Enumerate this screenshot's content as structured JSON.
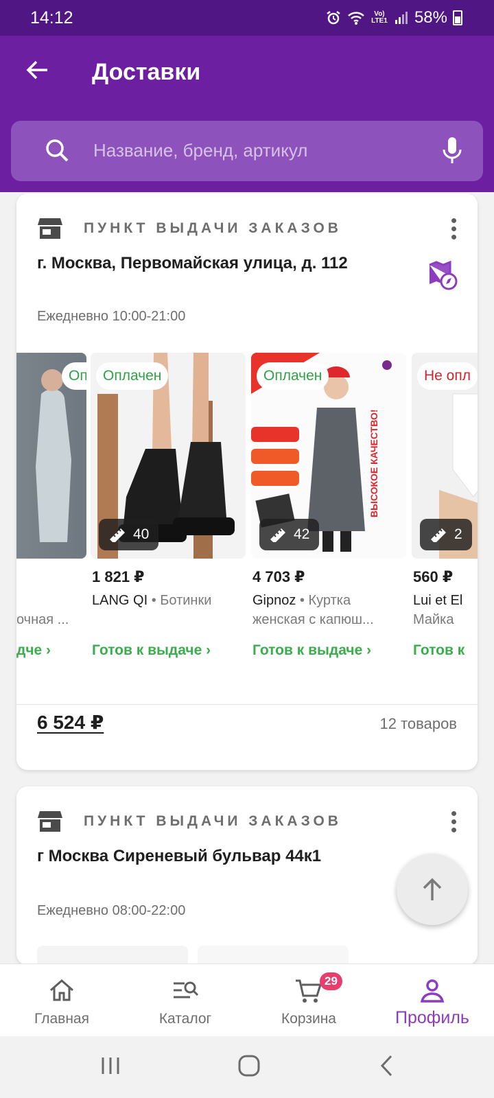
{
  "status_bar": {
    "time": "14:12",
    "network": "Vo) LTE1",
    "battery": "58%"
  },
  "header": {
    "title": "Доставки"
  },
  "search": {
    "placeholder": "Название, бренд, артикул"
  },
  "pickup_points": [
    {
      "type_label": "ПУНКТ ВЫДАЧИ ЗАКАЗОВ",
      "address": "г. Москва, Первомайская улица, д. 112",
      "hours": "Ежедневно 10:00-21:00",
      "products": [
        {
          "badge": "Оплачен",
          "size": "",
          "price": "",
          "brand": "",
          "category": "",
          "name": "очная ...",
          "status": "дче ›"
        },
        {
          "badge": "Оплачен",
          "size": "40",
          "price": "1 821 ₽",
          "brand": "LANG QI",
          "category": "Ботинки",
          "name": "",
          "status": "Готов к выдаче ›"
        },
        {
          "badge": "Оплачен",
          "size": "42",
          "price": "4 703 ₽",
          "brand": "Gipnoz",
          "category": "Куртка",
          "name": "женская с капюш...",
          "status": "Готов к выдаче ›"
        },
        {
          "badge": "Не опл",
          "size": "2",
          "price": "560 ₽",
          "brand": "Lui et El",
          "category": "",
          "name": "Майка",
          "status": "Готов к"
        }
      ],
      "total": "6 524 ₽",
      "items_count": "12 товаров"
    },
    {
      "type_label": "ПУНКТ ВЫДАЧИ ЗАКАЗОВ",
      "address": "г Москва Сиреневый бульвар 44к1",
      "hours": "Ежедневно 08:00-22:00"
    }
  ],
  "bottom_nav": [
    {
      "label": "Главная",
      "icon": "home-icon"
    },
    {
      "label": "Каталог",
      "icon": "catalog-search-icon"
    },
    {
      "label": "Корзина",
      "icon": "cart-icon",
      "badge": "29"
    },
    {
      "label": "Профиль",
      "icon": "profile-icon",
      "active": true
    }
  ],
  "colors": {
    "primary": "#6c1fa1",
    "status_bar": "#4f1684",
    "ready": "#3aae4c",
    "paid": "#2ea343",
    "unpaid": "#d2222a",
    "active_nav": "#8d3cbf",
    "cart_badge": "#e63e6d"
  }
}
